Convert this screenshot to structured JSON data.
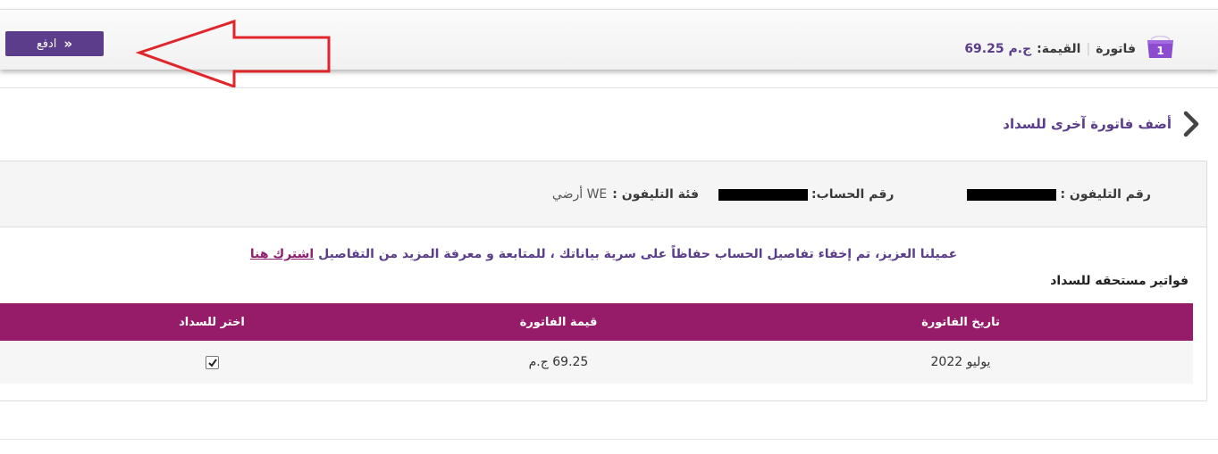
{
  "topbar": {
    "pay_button_label": "ادفع",
    "cart_count": "1",
    "bill_label": "فاتورة",
    "value_label": "القيمة:",
    "value_amount": "ج.م 69.25"
  },
  "add_bill": {
    "label": "أضف فاتورة آخرى للسداد"
  },
  "account_info": {
    "phone_label": "رقم التليفون :",
    "account_label": "رقم الحساب:",
    "phone_type_label": "فئة التليفون :",
    "phone_type_value": "WE أرضي"
  },
  "notice": {
    "text": "عميلنا العزيز، تم إخفاء تفاصيل الحساب حفاظاً على سرية بياناتك ، للمتابعة و معرفة المزيد من التفاصيل",
    "link_text": "اشترك هنا"
  },
  "due_bills": {
    "title": "فواتير مستحقه للسداد",
    "columns": [
      "تاريخ الفاتورة",
      "قيمة الفاتورة",
      "اختر للسداد"
    ],
    "rows": [
      {
        "date": "يوليو 2022",
        "amount": "69.25 ج.م",
        "selected": true
      }
    ]
  },
  "colors": {
    "brand_purple": "#5b3d8c",
    "table_header": "#961c6a",
    "annotation_red": "#e0262b"
  }
}
